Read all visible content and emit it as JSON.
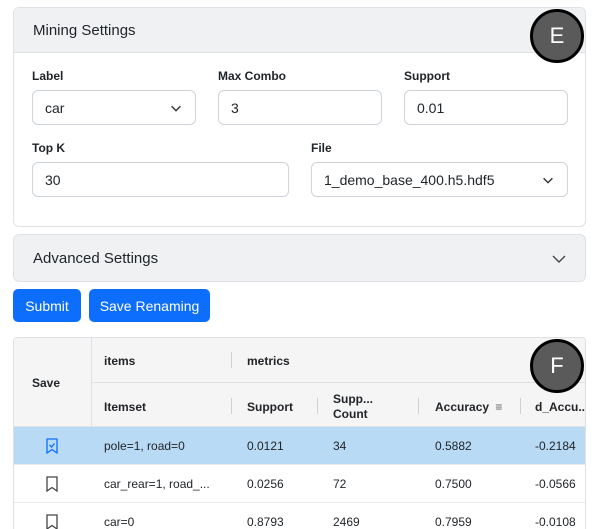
{
  "mining": {
    "title": "Mining Settings",
    "badge": "E",
    "label": {
      "label": "Label",
      "value": "car"
    },
    "max_combo": {
      "label": "Max Combo",
      "value": "3"
    },
    "support": {
      "label": "Support",
      "value": "0.01"
    },
    "top_k": {
      "label": "Top K",
      "value": "30"
    },
    "file": {
      "label": "File",
      "value": "1_demo_base_400.h5.hdf5"
    }
  },
  "advanced": {
    "title": "Advanced Settings"
  },
  "buttons": {
    "submit": "Submit",
    "save_renaming": "Save Renaming"
  },
  "table": {
    "badge": "F",
    "save_header": "Save",
    "group_items": "items",
    "group_metrics": "metrics",
    "columns": {
      "itemset": "Itemset",
      "support": "Support",
      "supp_count": "Supp...",
      "supp_count_2": "Count",
      "accuracy": "Accuracy",
      "d_accuracy": "d_Accu..."
    },
    "rows": [
      {
        "itemset": "pole=1, road=0",
        "support": "0.0121",
        "count": "34",
        "accuracy": "0.5882",
        "d_accuracy": "-0.2184",
        "saved": true
      },
      {
        "itemset": "car_rear=1, road_...",
        "support": "0.0256",
        "count": "72",
        "accuracy": "0.7500",
        "d_accuracy": "-0.0566",
        "saved": false
      },
      {
        "itemset": "car=0",
        "support": "0.8793",
        "count": "2469",
        "accuracy": "0.7959",
        "d_accuracy": "-0.0108",
        "saved": false
      }
    ]
  },
  "colors": {
    "primary": "#0d6efd",
    "selected_row": "#b8daf5",
    "header_bg": "#f0f1f3",
    "badge": "#5a5a5a"
  }
}
